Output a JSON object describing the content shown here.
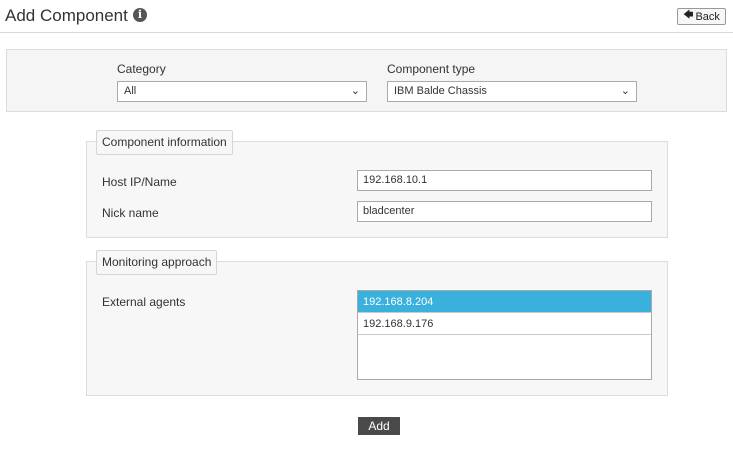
{
  "header": {
    "title": "Add Component",
    "info_icon": "info-icon",
    "back_label": "Back",
    "back_icon": "arrow-left-icon"
  },
  "filters": {
    "category_label": "Category",
    "category_value": "All",
    "component_type_label": "Component type",
    "component_type_value": "IBM Balde Chassis"
  },
  "component_info": {
    "legend": "Component information",
    "host_label": "Host IP/Name",
    "host_value": "192.168.10.1",
    "nick_label": "Nick name",
    "nick_value": "bladcenter"
  },
  "monitoring": {
    "legend": "Monitoring approach",
    "agents_label": "External agents",
    "agents": [
      {
        "label": "192.168.8.204",
        "selected": true
      },
      {
        "label": "192.168.9.176",
        "selected": false
      }
    ]
  },
  "actions": {
    "add_label": "Add"
  },
  "colors": {
    "selected_row": "#3ab0dc",
    "add_button": "#4a4a4a"
  }
}
